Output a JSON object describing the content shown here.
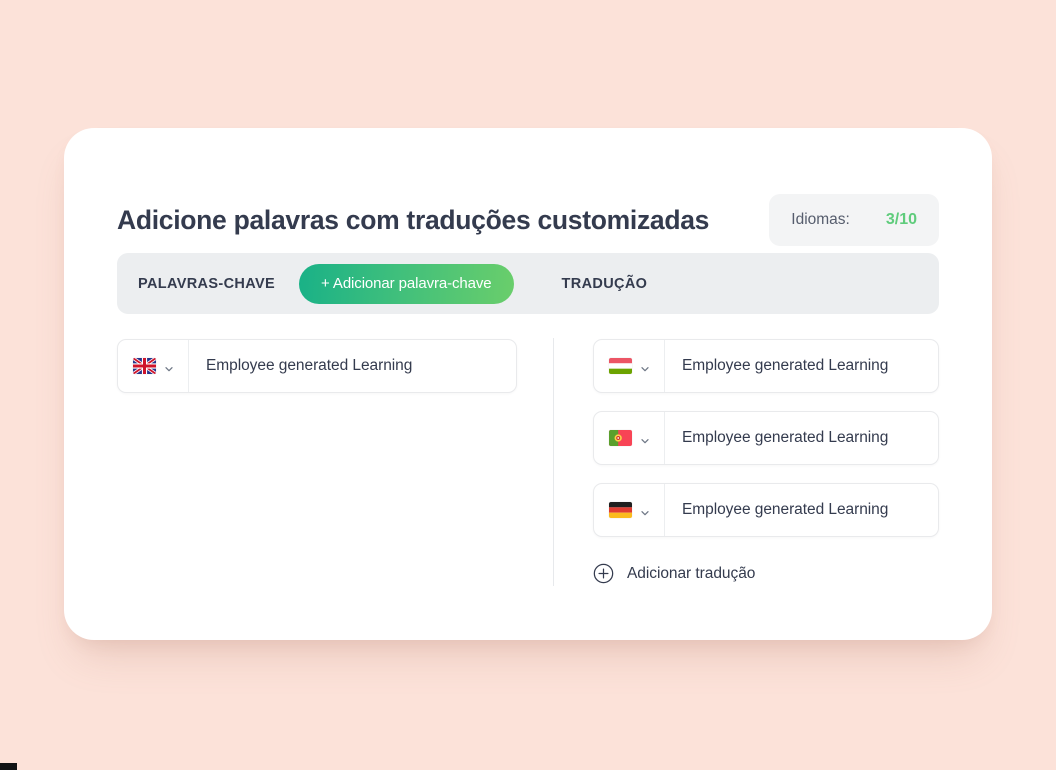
{
  "page": {
    "background_color": "#fce2d9"
  },
  "card": {
    "background_color": "#ffffff"
  },
  "header": {
    "title": "Adicione palavras com traduções customizadas",
    "badge": {
      "label": "Idiomas:",
      "count": "3/10",
      "count_color": "#5fcc7c",
      "background_color": "#f3f4f5"
    }
  },
  "tabbar": {
    "background_color": "#eceef0",
    "keywords_label": "PALAVRAS-CHAVE",
    "add_keyword_label": "+ Adicionar palavra-chave",
    "add_keyword_gradient_from": "#19b187",
    "add_keyword_gradient_to": "#6ace6b",
    "translation_label": "TRADUÇÃO"
  },
  "keywords": {
    "rows": [
      {
        "flag": "flag-uk",
        "flag_name": "united-kingdom-flag",
        "chevron": "chevron-down-icon",
        "value": "Employee generated Learning",
        "placeholder": "Employee generated Learning"
      }
    ]
  },
  "translations": {
    "rows": [
      {
        "flag": "flag-hu",
        "flag_name": "hungary-flag",
        "chevron": "chevron-down-icon",
        "value": "Employee generated Learning",
        "placeholder": "Employee generated Learning"
      },
      {
        "flag": "flag-pt",
        "flag_name": "portugal-flag",
        "chevron": "chevron-down-icon",
        "value": "Employee generated Learning",
        "placeholder": "Employee generated Learning"
      },
      {
        "flag": "flag-de",
        "flag_name": "germany-flag",
        "chevron": "chevron-down-icon",
        "value": "Employee generated Learning",
        "placeholder": "Employee generated Learning"
      }
    ],
    "add_translation_label": "Adicionar tradução",
    "add_translation_icon": "plus-circle-icon"
  }
}
